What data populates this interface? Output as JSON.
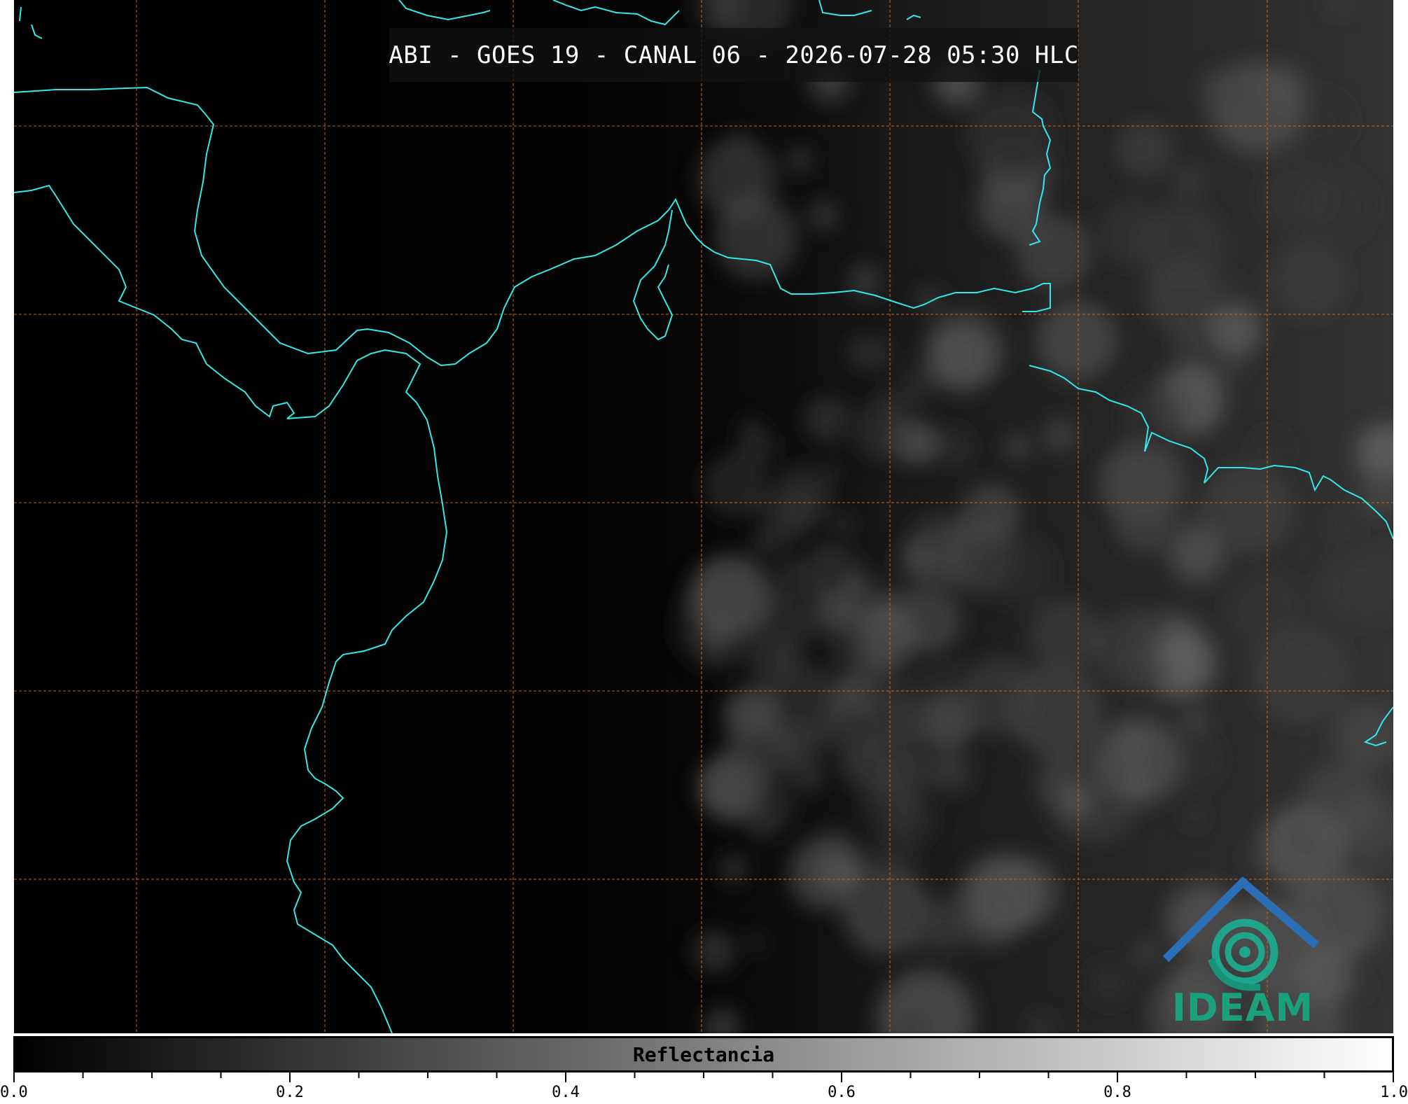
{
  "title": "ABI - GOES 19 - CANAL 06 - 2026-07-28 05:30 HLC",
  "colorbar": {
    "label": "Reflectancia",
    "min": 0.0,
    "max": 1.0,
    "tick_labels": [
      "0.0",
      "0.2",
      "0.4",
      "0.6",
      "0.8",
      "1.0"
    ],
    "colors": [
      "#000000",
      "#ffffff"
    ]
  },
  "map": {
    "background_color": "#000000",
    "coastline_color": "#33e8e8",
    "gridline_color": "#c8641e",
    "gridlines": "dashed"
  },
  "logo": {
    "text": "IDEAM",
    "roof_color": "#2a6fb5",
    "swirl_color": "#1fa58a"
  }
}
